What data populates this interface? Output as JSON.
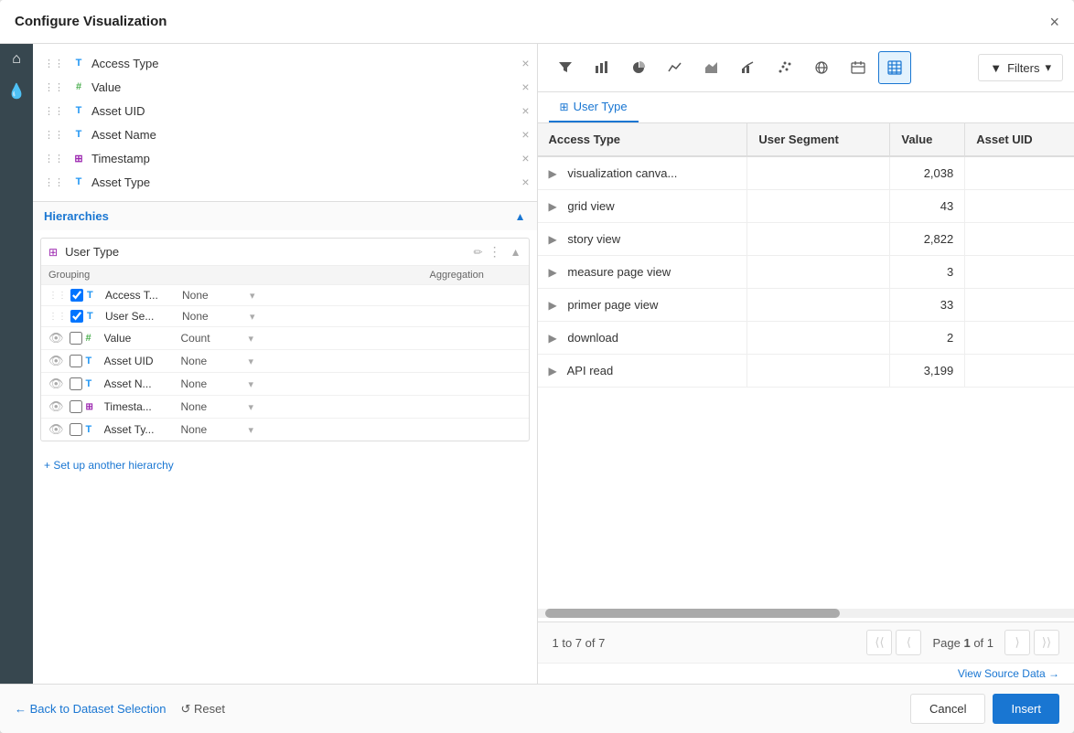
{
  "modal": {
    "title": "Configure Visualization",
    "close_label": "×"
  },
  "sidebar": {
    "fields": [
      {
        "type": "T",
        "name": "Access Type",
        "removable": true
      },
      {
        "type": "hash",
        "name": "Value",
        "removable": true
      },
      {
        "type": "T",
        "name": "Asset UID",
        "removable": true
      },
      {
        "type": "T",
        "name": "Asset Name",
        "removable": true
      },
      {
        "type": "grid",
        "name": "Timestamp",
        "removable": true
      },
      {
        "type": "T",
        "name": "Asset Type",
        "removable": true
      }
    ],
    "hierarchies_label": "Hierarchies",
    "hierarchy_group": {
      "name": "User Type",
      "rows": [
        {
          "visible": true,
          "checked": true,
          "type": "T",
          "name": "Access T...",
          "aggregation": "None"
        },
        {
          "visible": true,
          "checked": true,
          "type": "T",
          "name": "User Se...",
          "aggregation": "None"
        },
        {
          "visible": true,
          "checked": false,
          "type": "hash",
          "name": "Value",
          "aggregation": "Count"
        },
        {
          "visible": true,
          "checked": false,
          "type": "T",
          "name": "Asset UID",
          "aggregation": "None"
        },
        {
          "visible": true,
          "checked": false,
          "type": "T",
          "name": "Asset N...",
          "aggregation": "None"
        },
        {
          "visible": true,
          "checked": false,
          "type": "grid",
          "name": "Timesta...",
          "aggregation": "None"
        },
        {
          "visible": true,
          "checked": false,
          "type": "T",
          "name": "Asset Ty...",
          "aggregation": "None"
        }
      ],
      "grouping_col": "Grouping",
      "aggregation_col": "Aggregation"
    },
    "setup_link": "+ Set up another hierarchy"
  },
  "toolbar": {
    "buttons": [
      {
        "name": "filter-icon",
        "icon": "⊞",
        "active": false
      },
      {
        "name": "bar-chart-icon",
        "icon": "▦",
        "active": false
      },
      {
        "name": "pie-chart-icon",
        "icon": "◔",
        "active": false
      },
      {
        "name": "line-chart-icon",
        "icon": "〜",
        "active": false
      },
      {
        "name": "area-chart-icon",
        "icon": "∧",
        "active": false
      },
      {
        "name": "combo-chart-icon",
        "icon": "⌇",
        "active": false
      },
      {
        "name": "scatter-icon",
        "icon": "⁚",
        "active": false
      },
      {
        "name": "map-icon",
        "icon": "⊕",
        "active": false
      },
      {
        "name": "calendar-icon",
        "icon": "▦",
        "active": false
      },
      {
        "name": "table-icon",
        "icon": "⊞",
        "active": true
      }
    ],
    "filters_label": "Filters",
    "filters_chevron": "▾"
  },
  "tabs": [
    {
      "name": "User Type",
      "icon": "⊞",
      "active": true
    }
  ],
  "table": {
    "columns": [
      "Access Type",
      "User Segment",
      "Value",
      "Asset UID"
    ],
    "rows": [
      {
        "expand": true,
        "access_type": "visualization canva...",
        "user_segment": "",
        "value": "2,038",
        "asset_uid": ""
      },
      {
        "expand": true,
        "access_type": "grid view",
        "user_segment": "",
        "value": "43",
        "asset_uid": ""
      },
      {
        "expand": true,
        "access_type": "story view",
        "user_segment": "",
        "value": "2,822",
        "asset_uid": ""
      },
      {
        "expand": true,
        "access_type": "measure page view",
        "user_segment": "",
        "value": "3",
        "asset_uid": ""
      },
      {
        "expand": true,
        "access_type": "primer page view",
        "user_segment": "",
        "value": "33",
        "asset_uid": ""
      },
      {
        "expand": true,
        "access_type": "download",
        "user_segment": "",
        "value": "2",
        "asset_uid": ""
      },
      {
        "expand": true,
        "access_type": "API read",
        "user_segment": "",
        "value": "3,199",
        "asset_uid": ""
      }
    ]
  },
  "pagination": {
    "range": "1 to 7 of 7",
    "first_icon": "⟨⟨",
    "prev_icon": "⟨",
    "next_icon": "⟩",
    "last_icon": "⟩⟩",
    "page_text": "Page",
    "page_number": "1",
    "of_text": "of 1"
  },
  "source_link": "View Source Data →",
  "footer": {
    "back_label": "← Back to Dataset Selection",
    "reset_label": "↺ Reset",
    "cancel_label": "Cancel",
    "insert_label": "Insert"
  }
}
